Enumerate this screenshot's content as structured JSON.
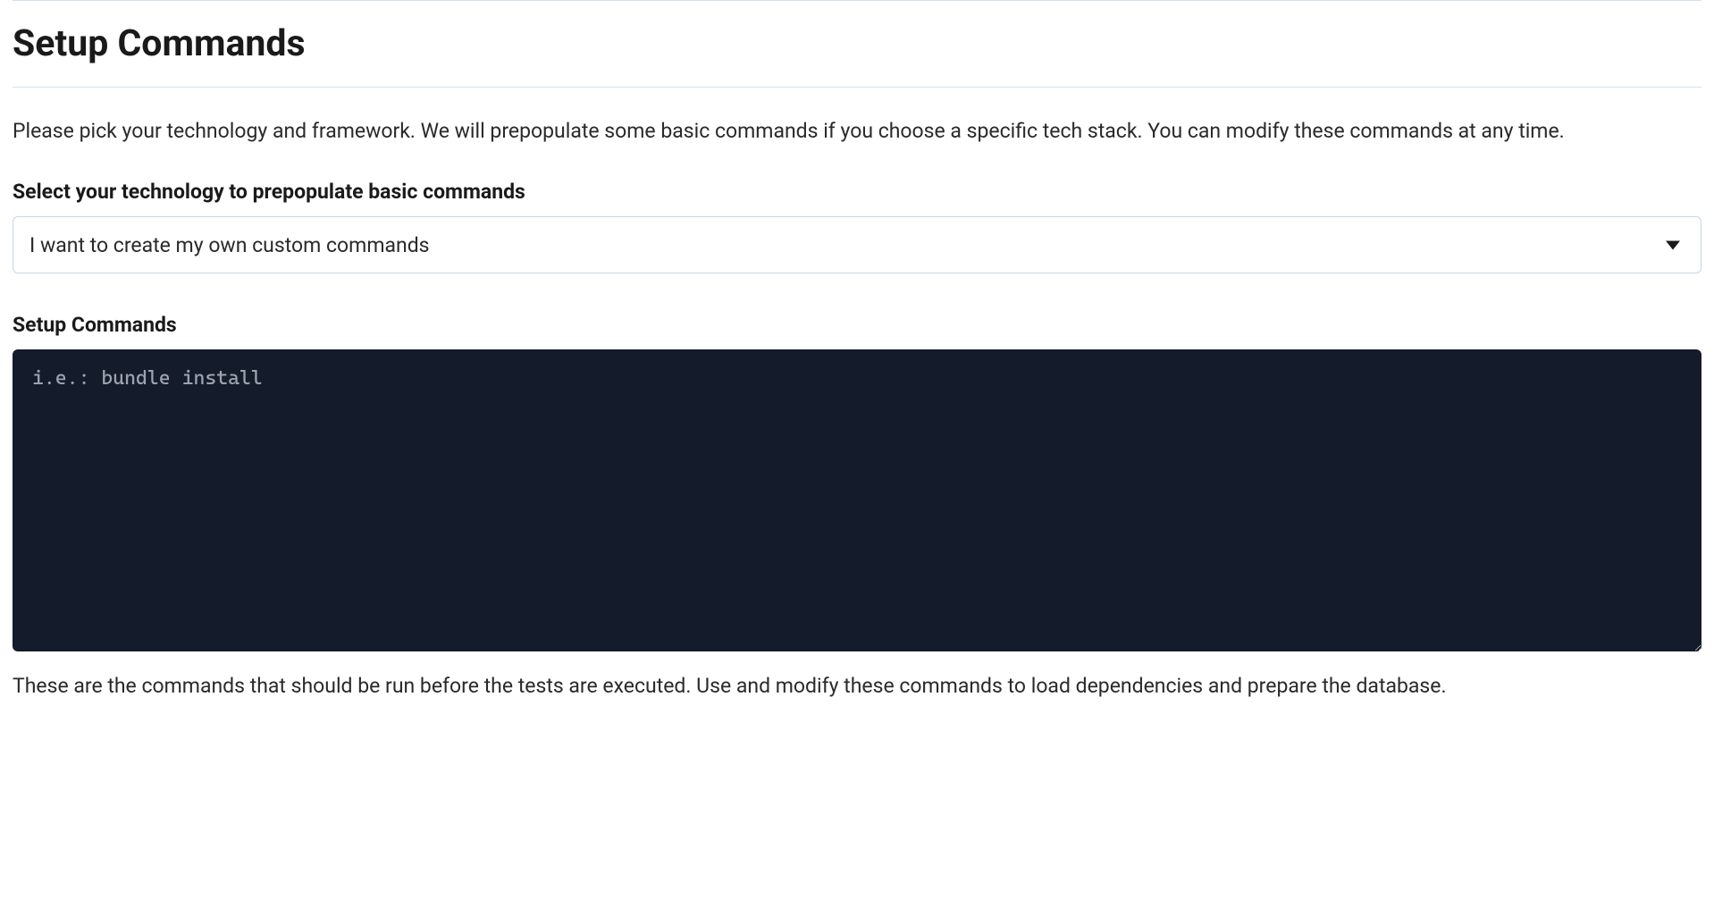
{
  "page": {
    "title": "Setup Commands",
    "description": "Please pick your technology and framework. We will prepopulate some basic commands if you choose a specific tech stack. You can modify these commands at any time."
  },
  "technology_select": {
    "label": "Select your technology to prepopulate basic commands",
    "selected": "I want to create my own custom commands"
  },
  "setup_commands": {
    "label": "Setup Commands",
    "placeholder": "i.e.: bundle install",
    "value": "",
    "helper": "These are the commands that should be run before the tests are executed. Use and modify these commands to load dependencies and prepare the database."
  }
}
